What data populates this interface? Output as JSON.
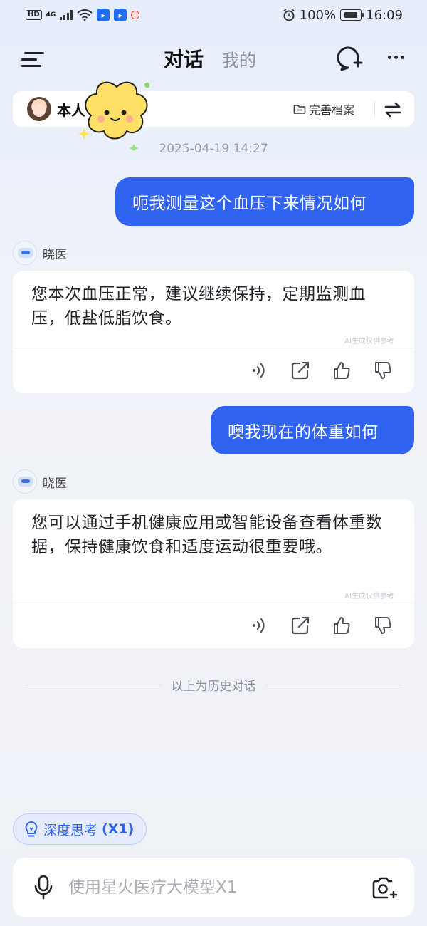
{
  "status_bar": {
    "hd": "HD",
    "network": "4G",
    "app1": "▸",
    "app2": "▸",
    "battery_percent": "100%",
    "time": "16:09"
  },
  "header": {
    "tab_active": "对话",
    "tab_inactive": "我的"
  },
  "profile": {
    "name": "本人",
    "complete_label": "完善档案"
  },
  "chat": {
    "timestamp": "2025-04-19 14:27",
    "bot_name": "晓医",
    "ai_note": "AI生成仅供参考",
    "messages": [
      {
        "role": "user",
        "text": "呃我测量这个血压下来情况如何"
      },
      {
        "role": "bot",
        "text": "您本次血压正常，建议继续保持，定期监测血压，低盐低脂饮食。"
      },
      {
        "role": "user",
        "text": "噢我现在的体重如何"
      },
      {
        "role": "bot",
        "text": "您可以通过手机健康应用或智能设备查看体重数据，保持健康饮食和适度运动很重要哦。"
      }
    ],
    "history_separator": "以上为历史对话"
  },
  "deep_think": {
    "label": "深度思考",
    "suffix": "(X1)"
  },
  "input": {
    "placeholder": "使用星火医疗大模型X1",
    "value": ""
  },
  "colors": {
    "accent": "#2f63f0",
    "background": "#eef2f9"
  }
}
